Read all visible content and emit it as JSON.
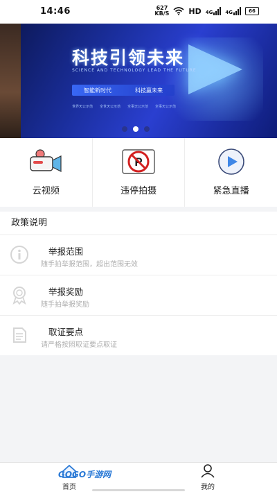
{
  "status_bar": {
    "time": "14:46",
    "net_speed_value": "627",
    "net_speed_unit": "KB/S",
    "hd_label": "HD",
    "signal1_label": "4G",
    "signal2_label": "4G",
    "battery_level": "66"
  },
  "banner": {
    "title": "科技引领未来",
    "subtitle": "SCIENCE AND TECHNOLOGY LEAD THE FUTURE",
    "pill_left": "智能新时代",
    "pill_right": "科技赢未来",
    "small_items": [
      "世界天公示范",
      "全世天公示范",
      "全事天公示范",
      "全事天公示范"
    ],
    "active_dot": 1
  },
  "features": [
    {
      "label": "云视频",
      "icon": "camera-icon"
    },
    {
      "label": "违停拍摄",
      "icon": "no-parking-icon"
    },
    {
      "label": "紧急直播",
      "icon": "play-icon"
    }
  ],
  "policy": {
    "heading": "政策说明",
    "items": [
      {
        "title": "举报范围",
        "subtitle": "随手拍举报范围，超出范围无效",
        "icon": "info-icon"
      },
      {
        "title": "举报奖励",
        "subtitle": "随手拍举报奖励",
        "icon": "award-icon"
      },
      {
        "title": "取证要点",
        "subtitle": "请严格按照取证要点取证",
        "icon": "document-icon"
      }
    ]
  },
  "nav": {
    "home_label": "首页",
    "mine_label": "我的"
  },
  "watermark": "GOGO手游网",
  "colors": {
    "accent_blue": "#2b7ad6",
    "banner_blue": "#1a2e9c",
    "no_parking_red": "#d32020"
  }
}
